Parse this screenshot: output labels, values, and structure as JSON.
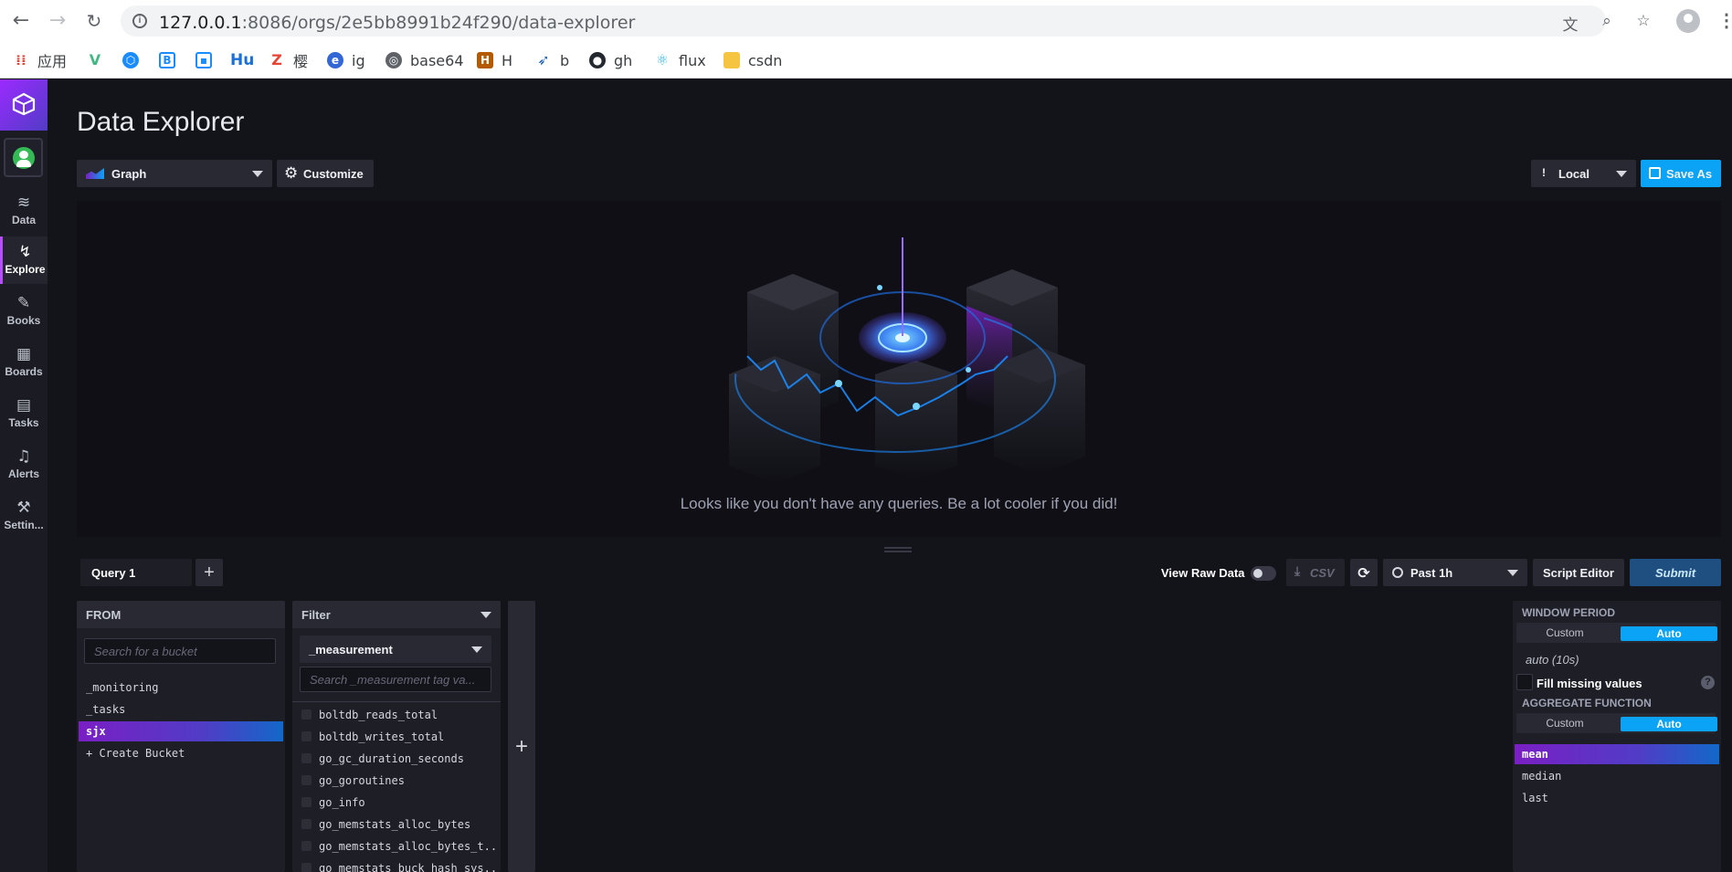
{
  "browser": {
    "url_host": "127.0.0.1",
    "url_path": ":8086/orgs/2e5bb8991b24f290/data-explorer",
    "bookmarks": [
      {
        "label": "应用",
        "icon": "apps-grid-icon",
        "color": "#e94335"
      },
      {
        "label": "",
        "icon": "vue-icon",
        "color": "#41b883"
      },
      {
        "label": "",
        "icon": "hexagon-icon",
        "color": "#1a8cff"
      },
      {
        "label": "",
        "icon": "bootstrap-icon",
        "color": "#1a8cff"
      },
      {
        "label": "",
        "icon": "bilibili-icon",
        "color": "#1a8cff"
      },
      {
        "label": "Hu",
        "icon": "",
        "color": "#1a6fd9"
      },
      {
        "label": "樱",
        "icon": "z-icon",
        "color": "#e94335"
      },
      {
        "label": "ig",
        "icon": "browser-icon",
        "color": "#3367d6"
      },
      {
        "label": "base64",
        "icon": "globe-icon",
        "color": "#5f6368"
      },
      {
        "label": "H",
        "icon": "bag-icon",
        "color": "#b35a00"
      },
      {
        "label": "b",
        "icon": "shoe-icon",
        "color": "#1a5fb4"
      },
      {
        "label": "gh",
        "icon": "github-icon",
        "color": "#24292f"
      },
      {
        "label": "flux",
        "icon": "react-icon",
        "color": "#33b5e5"
      },
      {
        "label": "csdn",
        "icon": "folder-icon",
        "color": "#f5c542"
      }
    ]
  },
  "sidebar": {
    "items": [
      {
        "label": "Data",
        "icon": "database-icon",
        "glyph": "🗄"
      },
      {
        "label": "Explore",
        "icon": "graph-icon",
        "glyph": "〰"
      },
      {
        "label": "Books",
        "icon": "notebook-icon",
        "glyph": "✎"
      },
      {
        "label": "Boards",
        "icon": "dashboard-icon",
        "glyph": "▦"
      },
      {
        "label": "Tasks",
        "icon": "calendar-icon",
        "glyph": "▤"
      },
      {
        "label": "Alerts",
        "icon": "bell-icon",
        "glyph": "🔔"
      },
      {
        "label": "Settin...",
        "icon": "wrench-icon",
        "glyph": "🔧"
      }
    ]
  },
  "page": {
    "title": "Data Explorer",
    "viz_type": "Graph",
    "customize": "Customize",
    "timezone": "Local",
    "save_as": "Save As",
    "empty_message": "Looks like you don't have any queries. Be a lot cooler if you did!"
  },
  "query_bar": {
    "query_tab": "Query 1",
    "add_tab": "+",
    "view_raw_data": "View Raw Data",
    "csv": "CSV",
    "time_range": "Past 1h",
    "script_editor": "Script Editor",
    "submit": "Submit"
  },
  "from_panel": {
    "title": "FROM",
    "search_placeholder": "Search for a bucket",
    "buckets": [
      "_monitoring",
      "_tasks",
      "sjx"
    ],
    "selected": "sjx",
    "create": "+ Create Bucket"
  },
  "filter_panel": {
    "title": "Filter",
    "key": "_measurement",
    "search_placeholder": "Search _measurement tag va...",
    "values": [
      "boltdb_reads_total",
      "boltdb_writes_total",
      "go_gc_duration_seconds",
      "go_goroutines",
      "go_info",
      "go_memstats_alloc_bytes",
      "go_memstats_alloc_bytes_t...",
      "go_memstats_buck_hash_sys..."
    ]
  },
  "add_filter": "+",
  "aggregate_panel": {
    "window_period_title": "WINDOW PERIOD",
    "custom": "Custom",
    "auto": "Auto",
    "auto_value": "auto (10s)",
    "fill_missing": "Fill missing values",
    "help": "?",
    "aggregate_title": "AGGREGATE FUNCTION",
    "functions": [
      "mean",
      "median",
      "last"
    ],
    "selected": "mean"
  },
  "colors": {
    "accent_purple": "#9b2aff",
    "accent_blue": "#0aa3f5",
    "background": "#13131a"
  }
}
